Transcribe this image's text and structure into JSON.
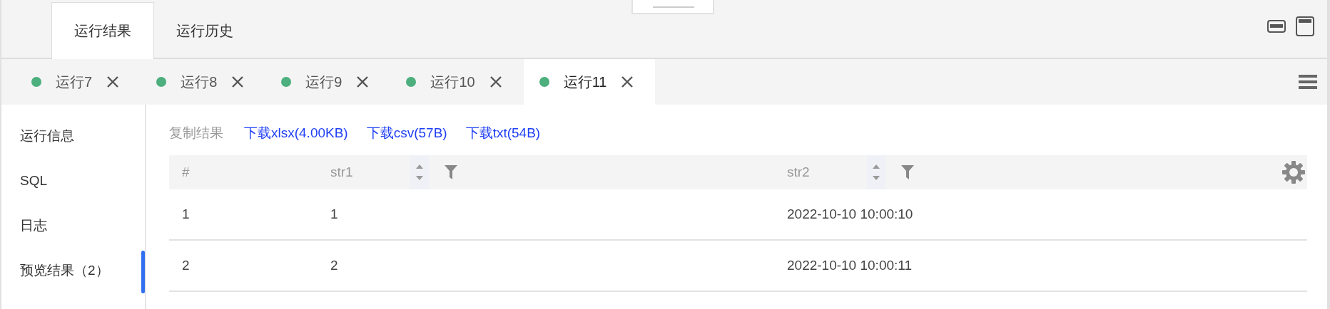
{
  "main_tabs": [
    {
      "label": "运行结果",
      "selected": true
    },
    {
      "label": "运行历史",
      "selected": false
    }
  ],
  "run_tabs": [
    {
      "label": "运行7",
      "selected": false
    },
    {
      "label": "运行8",
      "selected": false
    },
    {
      "label": "运行9",
      "selected": false
    },
    {
      "label": "运行10",
      "selected": false
    },
    {
      "label": "运行11",
      "selected": true
    }
  ],
  "sidebar": {
    "items": [
      {
        "label": "运行信息",
        "selected": false
      },
      {
        "label": "SQL",
        "selected": false
      },
      {
        "label": "日志",
        "selected": false
      },
      {
        "label": "预览结果（2）",
        "selected": true
      }
    ]
  },
  "actions": [
    {
      "label": "复制结果",
      "kind": "text"
    },
    {
      "label": "下载xlsx(4.00KB)",
      "kind": "link"
    },
    {
      "label": "下载csv(57B)",
      "kind": "link"
    },
    {
      "label": "下载txt(54B)",
      "kind": "link"
    }
  ],
  "table": {
    "columns": [
      {
        "label": "#",
        "sortable": false,
        "filterable": false
      },
      {
        "label": "str1",
        "sortable": true,
        "filterable": true
      },
      {
        "label": "str2",
        "sortable": true,
        "filterable": true
      }
    ],
    "rows": [
      [
        "1",
        "1",
        "2022-10-10 10:00:10"
      ],
      [
        "2",
        "2",
        "2022-10-10 10:00:11"
      ]
    ]
  }
}
